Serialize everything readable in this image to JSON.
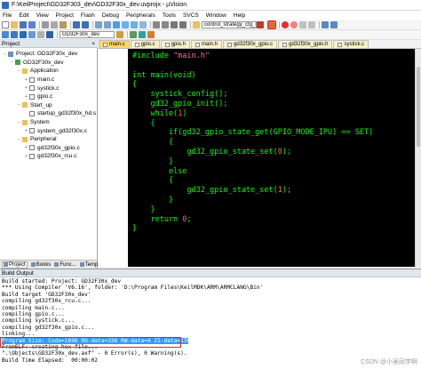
{
  "window": {
    "title": "F:\\KeilProject\\GD32F303_dev\\GD32F30x_dev.uvprojx - µVision"
  },
  "menu": [
    "File",
    "Edit",
    "View",
    "Project",
    "Flash",
    "Debug",
    "Peripherals",
    "Tools",
    "SVCS",
    "Window",
    "Help"
  ],
  "toolbar": {
    "target_combo": "control_strategy_cfg_m",
    "target_select": "GD32F30x_dev",
    "highlighted_button_icon": "debug-start-icon",
    "accent_color": "#e02020"
  },
  "project_panel": {
    "title": "Project",
    "tree": [
      {
        "label": "Project: GD32F30x_dev",
        "level": 0,
        "kind": "proj",
        "exp": "−"
      },
      {
        "label": "GD32F30x_dev",
        "level": 1,
        "kind": "target",
        "exp": "−"
      },
      {
        "label": "Application",
        "level": 2,
        "kind": "folder",
        "exp": "−"
      },
      {
        "label": "main.c",
        "level": 3,
        "kind": "file",
        "exp": "+"
      },
      {
        "label": "systick.c",
        "level": 3,
        "kind": "file",
        "exp": "+"
      },
      {
        "label": "gpio.c",
        "level": 3,
        "kind": "file",
        "exp": "+"
      },
      {
        "label": "Start_up",
        "level": 2,
        "kind": "folder",
        "exp": "−"
      },
      {
        "label": "startup_gd32f30x_hd.s",
        "level": 3,
        "kind": "file",
        "exp": ""
      },
      {
        "label": "System",
        "level": 2,
        "kind": "folder",
        "exp": "−"
      },
      {
        "label": "system_gd32f30x.c",
        "level": 3,
        "kind": "file",
        "exp": "+"
      },
      {
        "label": "Peripheral",
        "level": 2,
        "kind": "folder",
        "exp": "−"
      },
      {
        "label": "gd32f30x_gpio.c",
        "level": 3,
        "kind": "file",
        "exp": "+"
      },
      {
        "label": "gd32f30x_rcu.c",
        "level": 3,
        "kind": "file",
        "exp": "+"
      }
    ],
    "tabs": [
      "Project",
      "Books",
      "Func...",
      "Temp..."
    ]
  },
  "editor": {
    "tabs": [
      "main.c",
      "gpio.c",
      "gpio.h",
      "main.h",
      "gd32f30x_gpio.c",
      "gd32f30x_gpio.h",
      "systick.c"
    ],
    "active_tab": 0,
    "lines": [
      [
        [
          "#include ",
          "k"
        ],
        [
          "\"main.h\"",
          "s"
        ]
      ],
      [],
      [
        [
          "int main(void)",
          "k"
        ]
      ],
      [
        [
          "{",
          "k"
        ]
      ],
      [
        [
          "    systick_config();",
          "k"
        ]
      ],
      [
        [
          "    gd32_gpio_init();",
          "k"
        ]
      ],
      [
        [
          "    while(",
          "k"
        ],
        [
          "1",
          "n"
        ],
        [
          ")",
          "k"
        ]
      ],
      [
        [
          "    {",
          "k"
        ]
      ],
      [
        [
          "        if(gd32_gpio_state_get(GPIO_MODE_IPU) == SET)",
          "k"
        ]
      ],
      [
        [
          "        {",
          "k"
        ]
      ],
      [
        [
          "            gd32_gpio_state_set(",
          "k"
        ],
        [
          "0",
          "n"
        ],
        [
          ");",
          "k"
        ]
      ],
      [
        [
          "        }",
          "k"
        ]
      ],
      [
        [
          "        else",
          "k"
        ]
      ],
      [
        [
          "        {",
          "k"
        ]
      ],
      [
        [
          "            gd32_gpio_state_set(",
          "k"
        ],
        [
          "1",
          "n"
        ],
        [
          ");",
          "k"
        ]
      ],
      [
        [
          "        }",
          "k"
        ]
      ],
      [
        [
          "    }",
          "k"
        ]
      ],
      [
        [
          "    return ",
          "k"
        ],
        [
          "0",
          "n"
        ],
        [
          ";",
          "k"
        ]
      ],
      [
        [
          "}",
          "k"
        ]
      ]
    ]
  },
  "build_output": {
    "title": "Build Output",
    "lines": [
      "Build started: Project: GD32F30x_dev",
      "*** Using Compiler 'V6.16', folder: 'D:\\Program Files\\KeilMDK\\ARM\\ARMCLANG\\Bin'",
      "Build target 'GD32F30x_dev'",
      "compiling gd32f30x_rcu.c...",
      "compiling main.c...",
      "compiling gpio.c...",
      "compiling systick.c...",
      "compiling gd32f30x_gpio.c...",
      "linking...",
      "Program Size: Code=1696 RO-data=336 RW-data=4 ZI-data=1300",
      "FromELF: creating hex file...",
      "\".\\Objects\\GD32F30x_dev.axf\" - 0 Error(s), 0 Warning(s).",
      "Build Time Elapsed:  00:00:02"
    ],
    "selected_line": 9
  },
  "watermark": "CSDN @小吴同学啊"
}
